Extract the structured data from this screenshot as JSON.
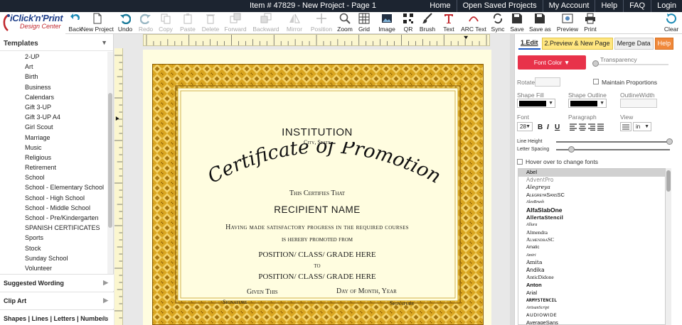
{
  "topbar": {
    "item_title": "Item # 47829 - New Project - Page 1",
    "nav": [
      "Home",
      "Open Saved Projects",
      "My Account",
      "Help",
      "FAQ",
      "Login"
    ]
  },
  "logo": {
    "line1": "iClick'n'Print",
    "line2": "Design Center"
  },
  "toolbar": {
    "tools": [
      {
        "label": "Back",
        "icon": "back-arrow-icon",
        "enabled": true
      },
      {
        "label": "New Project",
        "icon": "new-document-icon",
        "enabled": true
      },
      {
        "label": "Undo",
        "icon": "undo-icon",
        "enabled": true
      },
      {
        "label": "Redo",
        "icon": "redo-icon",
        "enabled": false
      },
      {
        "label": "Copy",
        "icon": "copy-icon",
        "enabled": false
      },
      {
        "label": "Paste",
        "icon": "paste-icon",
        "enabled": false
      },
      {
        "label": "Delete",
        "icon": "trash-icon",
        "enabled": false
      },
      {
        "label": "Forward",
        "icon": "bring-forward-icon",
        "enabled": false
      },
      {
        "label": "Backward",
        "icon": "send-backward-icon",
        "enabled": false
      },
      {
        "label": "Mirror",
        "icon": "mirror-icon",
        "enabled": false
      },
      {
        "label": "Position",
        "icon": "position-icon",
        "enabled": false
      },
      {
        "label": "Zoom",
        "icon": "zoom-icon",
        "enabled": true
      },
      {
        "label": "Grid",
        "icon": "grid-icon",
        "enabled": true
      },
      {
        "label": "Image",
        "icon": "image-icon",
        "enabled": true
      },
      {
        "label": "QR",
        "icon": "qr-code-icon",
        "enabled": true
      },
      {
        "label": "Brush",
        "icon": "brush-icon",
        "enabled": true
      },
      {
        "label": "Text",
        "icon": "text-icon",
        "enabled": true
      },
      {
        "label": "ARC Text",
        "icon": "arc-text-icon",
        "enabled": true
      },
      {
        "label": "Sync",
        "icon": "sync-icon",
        "enabled": true
      },
      {
        "label": "Save",
        "icon": "save-icon",
        "enabled": true
      },
      {
        "label": "Save as",
        "icon": "save-as-icon",
        "enabled": true
      },
      {
        "label": "Preview",
        "icon": "preview-icon",
        "enabled": true
      },
      {
        "label": "Print",
        "icon": "print-icon",
        "enabled": true
      },
      {
        "label": "Clear",
        "icon": "clear-icon",
        "enabled": true
      }
    ]
  },
  "left_panel": {
    "header": "Templates",
    "items": [
      "2-UP",
      "Art",
      "Birth",
      "Business",
      "Calendars",
      "Gift 3-UP",
      "Gift 3-UP A4",
      "Girl Scout",
      "Marriage",
      "Music",
      "Religious",
      "Retirement",
      "School",
      "School - Elementary School",
      "School - High School",
      "School - Middle School",
      "School - Pre/Kindergarten",
      "SPANISH CERTIFICATES",
      "Sports",
      "Stock",
      "Sunday School",
      "Volunteer"
    ],
    "sections": [
      "Suggested Wording",
      "Clip Art",
      "Shapes | Lines | Letters | Numbers"
    ]
  },
  "certificate": {
    "institution": "INSTITUTION",
    "city": "City, State",
    "title": "Certificate of Promotion",
    "certifies": "This Certifies That",
    "recipient": "RECIPIENT NAME",
    "progress_line1": "Having made satisfactory progress in the required courses",
    "progress_line2": "is hereby promoted from",
    "position1": "POSITION/ CLASS/ GRADE HERE",
    "to": "to",
    "position2": "POSITION/ CLASS/ GRADE HERE",
    "given": "Given This",
    "date": "Day of Month, Year",
    "signature_left": "Signature",
    "signature_right": "Signature",
    "border_color": "#c9a227"
  },
  "right_panel": {
    "tabs": [
      "1.Edit",
      "2.Preview & New Page",
      "Merge Data",
      "Help"
    ],
    "font_color_label": "Font Color",
    "transparency_label": "Transparency",
    "rotate_label": "Rotate",
    "maintain_proportions_label": "Maintain Proportions",
    "shape_fill_label": "Shape Fill",
    "shape_outline_label": "Shape Outline",
    "outline_width_label": "OutlineWidth",
    "font_label": "Font",
    "paragraph_label": "Paragraph",
    "view_label": "View",
    "font_size": "28",
    "view_unit": "in",
    "bold": "B",
    "italic": "I",
    "underline": "U",
    "line_height_label": "Line Height",
    "letter_spacing_label": "Letter Spacing",
    "hover_fonts_label": "Hover over to change fonts",
    "fonts": [
      "Abel",
      "AdventPro",
      "Alegreya",
      "AlegreyaSansSC",
      "AlexBrush",
      "AlfaSlabOne",
      "AllertaStencil",
      "Allura",
      "Almendra",
      "AlmendraSC",
      "Amatic",
      "Amiri",
      "Amita",
      "Andika",
      "AnticDidone",
      "Anton",
      "Arial",
      "ArmyStencil",
      "ArtisanScript",
      "Audiowide",
      "AverageSans"
    ],
    "accent_color": "#e8324a"
  }
}
